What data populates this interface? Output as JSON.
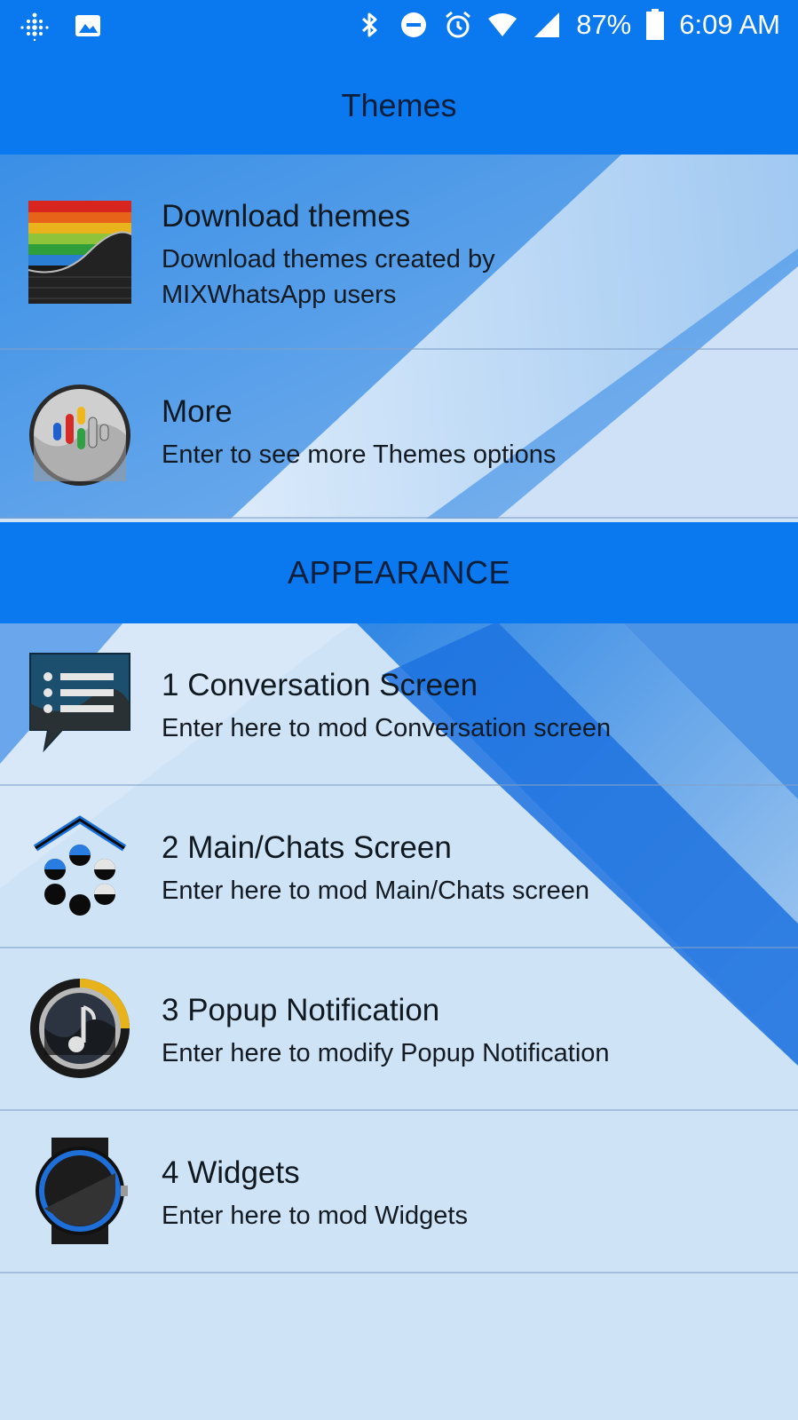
{
  "status_bar": {
    "battery": "87%",
    "time": "6:09 AM",
    "icons": [
      "fitbit-icon",
      "image-icon",
      "bluetooth-icon",
      "do-not-disturb-icon",
      "alarm-icon",
      "wifi-icon",
      "signal-icon",
      "battery-icon"
    ]
  },
  "header": {
    "title": "Themes"
  },
  "themes_items": [
    {
      "title": "Download themes",
      "subtitle": "Download themes created by MIXWhatsApp users",
      "icon": "rainbow-stripes-icon"
    },
    {
      "title": "More",
      "subtitle": "Enter to see more Themes options",
      "icon": "dots-disc-icon"
    }
  ],
  "appearance_section": {
    "title": "APPEARANCE"
  },
  "appearance_items": [
    {
      "title": "1 Conversation Screen",
      "subtitle": "Enter here to mod Conversation screen",
      "icon": "chat-bubble-list-icon"
    },
    {
      "title": "2 Main/Chats Screen",
      "subtitle": "Enter here to mod Main/Chats screen",
      "icon": "home-dots-icon"
    },
    {
      "title": "3 Popup Notification",
      "subtitle": "Enter here to modify Popup Notification",
      "icon": "music-note-dial-icon"
    },
    {
      "title": "4 Widgets",
      "subtitle": "Enter here to mod Widgets",
      "icon": "watch-icon"
    }
  ],
  "colors": {
    "primary_blue": "#0a78ee",
    "list_background": "#cfe3f6",
    "text_dark": "#101820"
  }
}
